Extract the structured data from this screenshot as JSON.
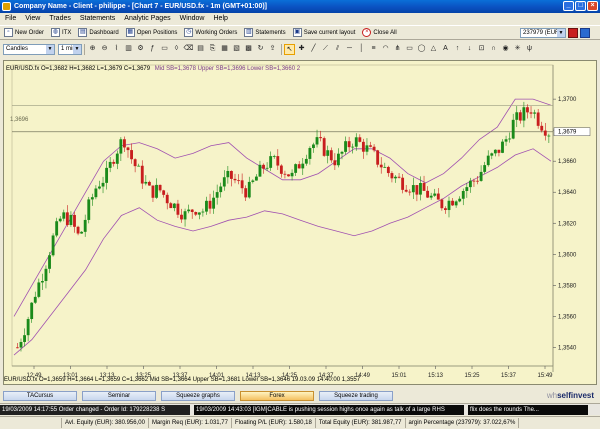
{
  "window": {
    "title": "Company Name - Client - philippe - [Chart 7 - EUR/USD.fx - 1m (GMT+01:00)]"
  },
  "menu": [
    "File",
    "View",
    "Trades",
    "Statements",
    "Analytic Pages",
    "Window",
    "Help"
  ],
  "toolbar": {
    "new_order": "New Order",
    "itx": "ITX",
    "dashboard": "Dashboard",
    "open_positions": "Open Positions",
    "working_orders": "Working Orders",
    "statements": "Statements",
    "save_layout": "Save current layout",
    "close_all": "Close All",
    "account": "237979 (EUR)"
  },
  "chart_toolbar": {
    "chart_type": "Candles",
    "interval": "1 min"
  },
  "chart_header": {
    "ohlc": "EUR/USD.fx O=1,3682 H=1,3682 L=1,3679 C=1,3679",
    "bb": "Mid SB=1,3678 Upper SB=1,3696 Lower SB=1,3660  2"
  },
  "price_line_label": "1,3696",
  "chart_footer": "EUR/USD.fx O=1,3659 H=1,3664 L=1,3659 C=1,3662  Mid SB=1,3664 Upper SB=1,3681 Lower SB=1,3646  19.03.09 14:40:00  1,3557",
  "tabs": [
    "TACursus",
    "Seminar",
    "Squeeze graphs",
    "Forex",
    "Squeeze trading"
  ],
  "active_tab": "Forex",
  "brand": {
    "prefix": "wh",
    "name": "selfinvest"
  },
  "news": {
    "order": "19/03/2009 14:17:55 Order changed - Order Id: 179228238 S",
    "headline": "19/03/2009 14:43:03 [IGM]CABLE is pushing session highs once again as talk of a large RHS",
    "tail": "flix does the rounds  The..."
  },
  "status": {
    "avl_equity": "Avl. Equity (EUR): 380.956,00",
    "margin_req": "Margin Req (EUR): 1.031,77",
    "floating_pl": "Floating P/L (EUR): 1.580,18",
    "total_equity": "Total Equity (EUR): 381.987,77",
    "margin_pct": "argin Percentage (237979): 37.022,67%"
  },
  "colors": {
    "bull": "#1a8a1a",
    "bear": "#c81e1e",
    "band": "#a050b0",
    "background": "#f6f3c9"
  },
  "chart_data": {
    "type": "candlestick",
    "symbol": "EUR/USD.fx",
    "x_ticks": [
      "12:49",
      "13:01",
      "13:13",
      "13:25",
      "13:37",
      "14:01",
      "14:13",
      "14:25",
      "14:37",
      "14:49",
      "15:01",
      "15:13",
      "15:25",
      "15:37",
      "15:49"
    ],
    "y_ticks": [
      "1,3700",
      "1,3680",
      "1,3660",
      "1,3640",
      "1,3620",
      "1,3600",
      "1,3580",
      "1,3560",
      "1,3540"
    ],
    "last_price": "1,3679",
    "ylim": [
      1.3528,
      1.3722
    ],
    "close_path": [
      1.354,
      1.3555,
      1.3575,
      1.359,
      1.361,
      1.3625,
      1.3622,
      1.361,
      1.363,
      1.3645,
      1.365,
      1.3665,
      1.3675,
      1.366,
      1.365,
      1.364,
      1.3642,
      1.3635,
      1.363,
      1.3625,
      1.363,
      1.3628,
      1.3635,
      1.3645,
      1.365,
      1.3645,
      1.364,
      1.365,
      1.3658,
      1.366,
      1.3655,
      1.365,
      1.366,
      1.367,
      1.3672,
      1.3665,
      1.366,
      1.3668,
      1.3674,
      1.367,
      1.3665,
      1.3658,
      1.3652,
      1.3648,
      1.3645,
      1.3642,
      1.364,
      1.3635,
      1.3632,
      1.3635,
      1.364,
      1.3645,
      1.365,
      1.366,
      1.3665,
      1.3672,
      1.3685,
      1.369,
      1.3694,
      1.3685,
      1.3679
    ],
    "bands": {
      "upper": [
        1.356,
        1.358,
        1.36,
        1.362,
        1.364,
        1.366,
        1.367,
        1.3672,
        1.3668,
        1.3662,
        1.3665,
        1.367,
        1.3672,
        1.3662,
        1.3655,
        1.3648,
        1.3648,
        1.3652,
        1.366,
        1.3668,
        1.3668,
        1.3662,
        1.3652,
        1.3646,
        1.3652,
        1.3662,
        1.3674,
        1.3682,
        1.37,
        1.37,
        1.3696
      ],
      "lower": [
        1.3535,
        1.3545,
        1.356,
        1.3575,
        1.359,
        1.361,
        1.3625,
        1.363,
        1.3622,
        1.3618,
        1.3615,
        1.3618,
        1.3622,
        1.3624,
        1.3628,
        1.3626,
        1.3622,
        1.3618,
        1.3615,
        1.3612,
        1.3615,
        1.362,
        1.3624,
        1.363,
        1.3636,
        1.3644,
        1.365,
        1.3656,
        1.3664,
        1.3668,
        1.366
      ]
    }
  }
}
